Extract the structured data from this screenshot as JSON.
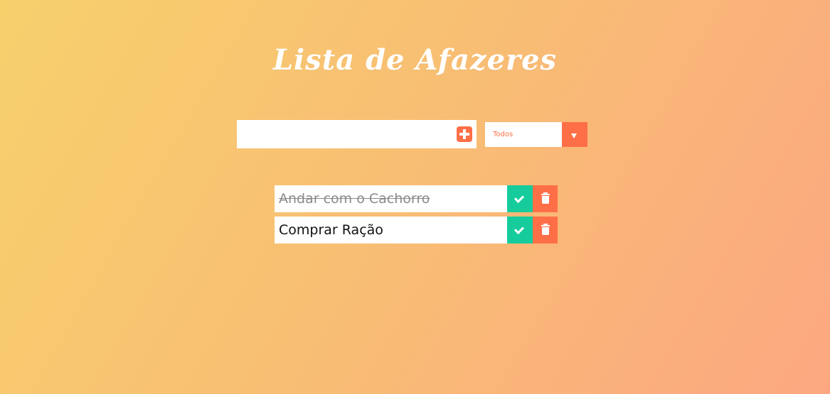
{
  "header": {
    "title": "Lista de Afazeres"
  },
  "new_todo": {
    "value": "",
    "placeholder": "",
    "add_icon": "plus-square-icon"
  },
  "filter": {
    "selected": "Todos",
    "icon": "caret-down-icon"
  },
  "todos": [
    {
      "text": "Andar com o Cachorro",
      "completed": true
    },
    {
      "text": "Comprar Ração",
      "completed": false
    }
  ],
  "colors": {
    "accent": "#ff6f47",
    "check": "#16cc9d",
    "background_start": "#f7d06c",
    "background_end": "#fca781"
  }
}
